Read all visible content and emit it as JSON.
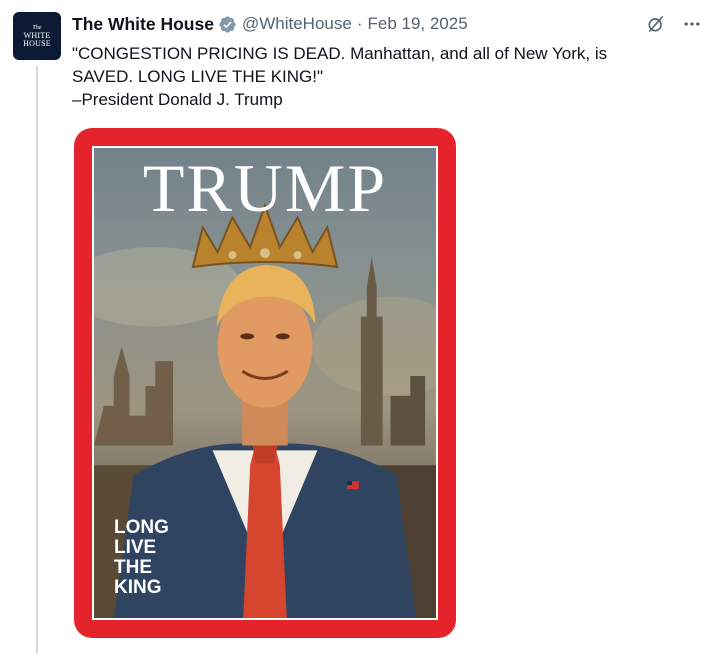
{
  "tweet": {
    "author_name": "The White House",
    "handle": "@WhiteHouse",
    "separator": "·",
    "date": "Feb 19, 2025",
    "avatar_lines": [
      "The",
      "WHITE",
      "HOUSE"
    ],
    "text_lines": [
      "\"CONGESTION PRICING IS DEAD. Manhattan, and all of New York, is",
      "SAVED. LONG LIVE THE KING!\"",
      "–President Donald J. Trump"
    ]
  },
  "icons": {
    "verified": "verified-badge-icon",
    "grok": "grok-icon",
    "more": "more-options-icon"
  },
  "media": {
    "masthead": "TRUMP",
    "tagline": [
      "LONG",
      "LIVE",
      "THE",
      "KING"
    ]
  },
  "colors": {
    "verified_badge": "#829aab",
    "cover_border": "#e5232b",
    "avatar_bg": "#0c1a35",
    "handle": "#536471"
  }
}
